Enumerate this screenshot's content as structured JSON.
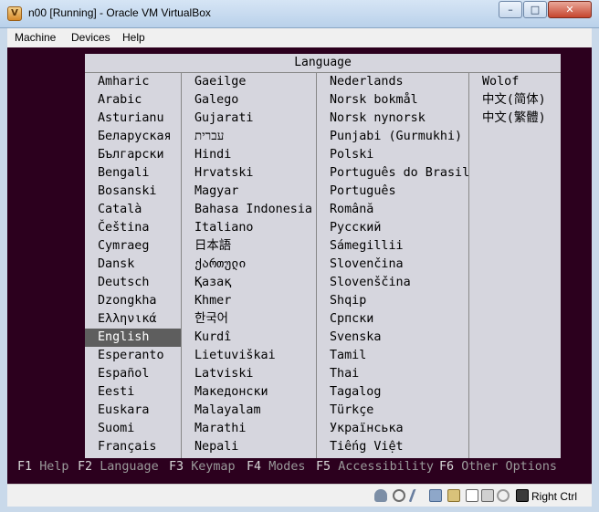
{
  "window": {
    "title": "n00 [Running] - Oracle VM VirtualBox",
    "minimize_glyph": "–",
    "maximize_glyph": "□",
    "close_glyph": "✕"
  },
  "menubar": [
    "Machine",
    "Devices",
    "Help"
  ],
  "dialog": {
    "title": "Language",
    "columns": [
      [
        "Amharic",
        "Arabic",
        "Asturianu",
        "Беларуская",
        "Български",
        "Bengali",
        "Bosanski",
        "Català",
        "Čeština",
        "Cymraeg",
        "Dansk",
        "Deutsch",
        "Dzongkha",
        "Ελληνικά",
        "English",
        "Esperanto",
        "Español",
        "Eesti",
        "Euskara",
        "Suomi",
        "Français"
      ],
      [
        "Gaeilge",
        "Galego",
        "Gujarati",
        "עברית",
        "Hindi",
        "Hrvatski",
        "Magyar",
        "Bahasa Indonesia",
        "Italiano",
        "日本語",
        "ქართული",
        "Қазақ",
        "Khmer",
        "한국어",
        "Kurdî",
        "Lietuviškai",
        "Latviski",
        "Македонски",
        "Malayalam",
        "Marathi",
        "Nepali"
      ],
      [
        "Nederlands",
        "Norsk bokmål",
        "Norsk nynorsk",
        "Punjabi (Gurmukhi)",
        "Polski",
        "Português do Brasil",
        "Português",
        "Română",
        "Русский",
        "Sámegillii",
        "Slovenčina",
        "Slovenščina",
        "Shqip",
        "Српски",
        "Svenska",
        "Tamil",
        "Thai",
        "Tagalog",
        "Türkçe",
        "Українська",
        "Tiếng Việt"
      ],
      [
        "Wolof",
        "中文(简体)",
        "中文(繁體)"
      ]
    ],
    "selected": "English"
  },
  "function_keys": [
    {
      "key": "F1",
      "label": "Help"
    },
    {
      "key": "F2",
      "label": "Language"
    },
    {
      "key": "F3",
      "label": "Keymap"
    },
    {
      "key": "F4",
      "label": "Modes"
    },
    {
      "key": "F5",
      "label": "Accessibility"
    },
    {
      "key": "F6",
      "label": "Other Options"
    }
  ],
  "statusbar": {
    "icons": [
      "hard-disk-icon",
      "optical-drive-icon",
      "usb-icon",
      "network-icon",
      "shared-folders-icon",
      "display-icon",
      "video-capture-icon",
      "mouse-integration-icon",
      "keyboard-capture-icon"
    ],
    "host_key": "Right Ctrl"
  }
}
